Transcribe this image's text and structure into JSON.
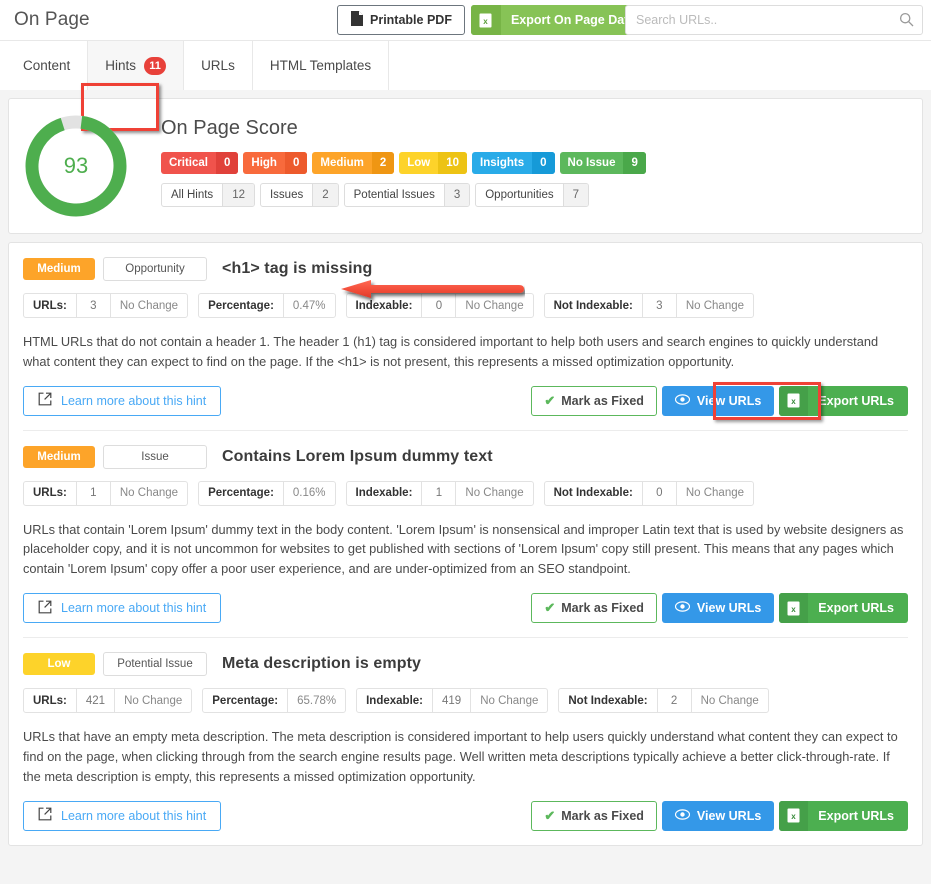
{
  "header": {
    "title": "On Page",
    "printable_pdf_label": "Printable PDF",
    "export_label": "Export On Page Data",
    "search_placeholder": "Search URLs.."
  },
  "tabs": [
    {
      "label": "Content",
      "badge": "",
      "active": false
    },
    {
      "label": "Hints",
      "badge": "11",
      "active": true
    },
    {
      "label": "URLs",
      "badge": "",
      "active": false
    },
    {
      "label": "HTML Templates",
      "badge": "",
      "active": false
    }
  ],
  "score": {
    "title": "On Page Score",
    "value": "93",
    "percent": 93,
    "ring_color": "#4eae4e",
    "ring_track_color": "#e2e2e2",
    "severities": [
      {
        "label": "Critical",
        "count": "0",
        "color": "#f0534c",
        "dark": "#e0413a"
      },
      {
        "label": "High",
        "count": "0",
        "color": "#f86a3c",
        "dark": "#ed5a2c"
      },
      {
        "label": "Medium",
        "count": "2",
        "color": "#fda429",
        "dark": "#ef9613"
      },
      {
        "label": "Low",
        "count": "10",
        "color": "#fdd32a",
        "dark": "#edc314"
      },
      {
        "label": "Insights",
        "count": "0",
        "color": "#29abe8",
        "dark": "#169ad8"
      },
      {
        "label": "No Issue",
        "count": "9",
        "color": "#5cb85c",
        "dark": "#4aa84a"
      }
    ],
    "filters": [
      {
        "label": "All Hints",
        "count": "12"
      },
      {
        "label": "Issues",
        "count": "2"
      },
      {
        "label": "Potential Issues",
        "count": "3"
      },
      {
        "label": "Opportunities",
        "count": "7"
      }
    ]
  },
  "actions": {
    "learn_more_label": "Learn more about this hint",
    "mark_fixed_label": "Mark as Fixed",
    "view_urls_label": "View URLs",
    "export_urls_label": "Export URLs"
  },
  "stat_keys": {
    "urls": "URLs:",
    "percentage": "Percentage:",
    "indexable": "Indexable:",
    "not_indexable": "Not Indexable:"
  },
  "hints": [
    {
      "severity": "Medium",
      "severity_color": "#fda429",
      "type": "Opportunity",
      "title": "<h1> tag is missing",
      "urls": "3",
      "urls_change": "No Change",
      "percentage": "0.47%",
      "indexable": "0",
      "indexable_change": "No Change",
      "not_indexable": "3",
      "not_indexable_change": "No Change",
      "description": "HTML URLs that do not contain a header 1. The header 1 (h1) tag is considered important to help both users and search engines to quickly understand what content they can expect to find on the page. If the <h1> is not present, this represents a missed optimization opportunity."
    },
    {
      "severity": "Medium",
      "severity_color": "#fda429",
      "type": "Issue",
      "title": "Contains Lorem Ipsum dummy text",
      "urls": "1",
      "urls_change": "No Change",
      "percentage": "0.16%",
      "indexable": "1",
      "indexable_change": "No Change",
      "not_indexable": "0",
      "not_indexable_change": "No Change",
      "description": "URLs that contain 'Lorem Ipsum' dummy text in the body content. 'Lorem Ipsum' is nonsensical and improper Latin text that is used by website designers as placeholder copy, and it is not uncommon for websites to get published with sections of 'Lorem Ipsum' copy still present. This means that any pages which contain 'Lorem Ipsum' copy offer a poor user experience, and are under-optimized from an SEO standpoint."
    },
    {
      "severity": "Low",
      "severity_color": "#fdd32a",
      "type": "Potential Issue",
      "title": "Meta description is empty",
      "urls": "421",
      "urls_change": "No Change",
      "percentage": "65.78%",
      "indexable": "419",
      "indexable_change": "No Change",
      "not_indexable": "2",
      "not_indexable_change": "No Change",
      "description": "URLs that have an empty meta description. The meta description is considered important to help users quickly understand what content they can expect to find on the page, when clicking through from the search engine results page. Well written meta descriptions typically achieve a better click-through-rate. If the meta description is empty, this represents a missed optimization opportunity."
    }
  ],
  "annotations": {
    "highlight_color": "#ef4136",
    "arrow_color": "#f4503c",
    "highlighted_tab": "Hints",
    "arrow_points_to": "<h1> tag is missing",
    "highlighted_button": "View URLs"
  }
}
